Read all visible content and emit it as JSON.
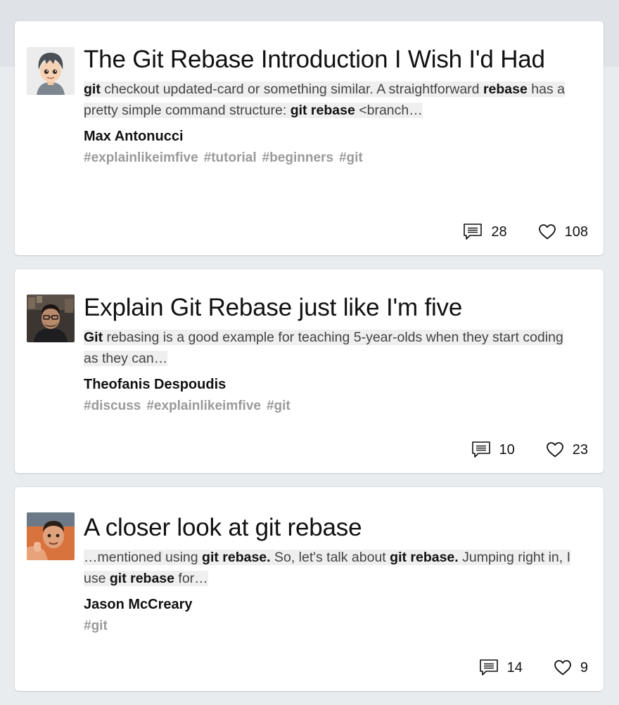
{
  "colors": {
    "background": "#e9ecef",
    "card": "#ffffff",
    "highlight": "#efefef",
    "tag": "#9a9a9a"
  },
  "icons": {
    "comments": "comment-icon",
    "likes": "heart-icon"
  },
  "articles": [
    {
      "title": "The Git Rebase Introduction I Wish I'd Had",
      "snippet": [
        {
          "t": "git",
          "b": true
        },
        {
          "t": " checkout updated-card or something similar. A straightforward ",
          "b": false
        },
        {
          "t": "rebase",
          "b": true
        },
        {
          "t": " has a pretty simple command structure: ",
          "b": false
        },
        {
          "t": "git rebase",
          "b": true
        },
        {
          "t": " <branch…",
          "b": false
        }
      ],
      "author": "Max Antonucci",
      "tags": [
        "#explainlikeimfive",
        "#tutorial",
        "#beginners",
        "#git"
      ],
      "comments": "28",
      "likes": "108"
    },
    {
      "title": "Explain Git Rebase just like I'm five",
      "snippet": [
        {
          "t": "Git",
          "b": true
        },
        {
          "t": " rebasing is a good example for teaching 5-year-olds when they start coding as they can…",
          "b": false
        }
      ],
      "author": "Theofanis Despoudis",
      "tags": [
        "#discuss",
        "#explainlikeimfive",
        "#git"
      ],
      "comments": "10",
      "likes": "23"
    },
    {
      "title": "A closer look at git rebase",
      "snippet": [
        {
          "t": "…mentioned using ",
          "b": false
        },
        {
          "t": "git rebase.",
          "b": true
        },
        {
          "t": " So, let's talk about ",
          "b": false
        },
        {
          "t": "git rebase.",
          "b": true
        },
        {
          "t": " Jumping right in, I use ",
          "b": false
        },
        {
          "t": "git rebase",
          "b": true
        },
        {
          "t": " for…",
          "b": false
        }
      ],
      "author": "Jason McCreary",
      "tags": [
        "#git"
      ],
      "comments": "14",
      "likes": "9"
    }
  ]
}
